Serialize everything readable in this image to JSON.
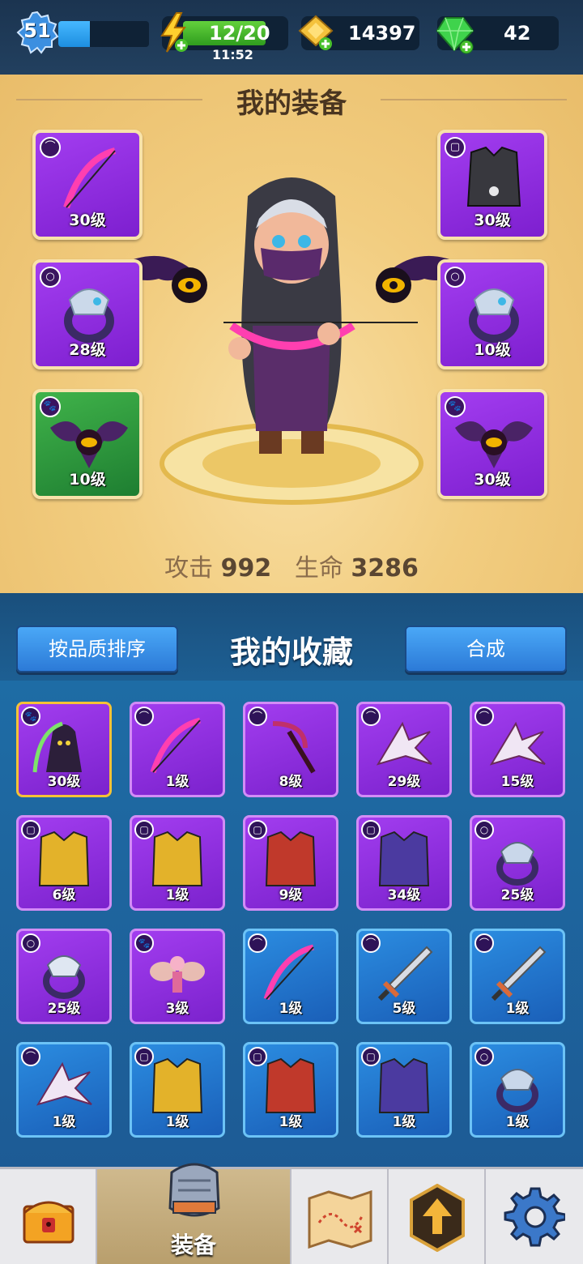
{
  "topbar": {
    "player_level": "51",
    "xp_progress": 0.35,
    "energy": "12/20",
    "energy_timer": "11:52",
    "gold": "14397",
    "gems": "42"
  },
  "equipment": {
    "title": "我的装备",
    "slots": [
      {
        "slot": "weapon",
        "level": "30级",
        "icon": "bow-icon",
        "rarity": "purple"
      },
      {
        "slot": "armor",
        "level": "30级",
        "icon": "armor-icon",
        "rarity": "purple"
      },
      {
        "slot": "ring",
        "level": "28级",
        "icon": "ring-icon",
        "rarity": "purple"
      },
      {
        "slot": "ring",
        "level": "10级",
        "icon": "ring-icon",
        "rarity": "purple"
      },
      {
        "slot": "pet",
        "level": "10级",
        "icon": "bat-pet-icon",
        "rarity": "green"
      },
      {
        "slot": "pet",
        "level": "30级",
        "icon": "bat-pet-icon",
        "rarity": "purple"
      }
    ],
    "stats": {
      "attack_label": "攻击",
      "attack_value": "992",
      "hp_label": "生命",
      "hp_value": "3286"
    }
  },
  "collection": {
    "sort_button": "按品质排序",
    "title": "我的收藏",
    "merge_button": "合成",
    "items": [
      {
        "level": "30级",
        "icon": "reaper-pet-icon",
        "type": "pet",
        "rarity": "purple"
      },
      {
        "level": "1级",
        "icon": "bow-icon",
        "type": "weapon",
        "rarity": "purple"
      },
      {
        "level": "8级",
        "icon": "scythe-icon",
        "type": "weapon",
        "rarity": "purple"
      },
      {
        "level": "29级",
        "icon": "shuriken-icon",
        "type": "weapon",
        "rarity": "purple"
      },
      {
        "level": "15级",
        "icon": "shuriken-icon",
        "type": "weapon",
        "rarity": "purple"
      },
      {
        "level": "6级",
        "icon": "gold-armor-icon",
        "type": "armor",
        "rarity": "purple"
      },
      {
        "level": "1级",
        "icon": "gold-armor-icon",
        "type": "armor",
        "rarity": "purple"
      },
      {
        "level": "9级",
        "icon": "cloak-armor-icon",
        "type": "armor",
        "rarity": "purple"
      },
      {
        "level": "34级",
        "icon": "vest-armor-icon",
        "type": "armor",
        "rarity": "purple"
      },
      {
        "level": "25级",
        "icon": "bear-ring-icon",
        "type": "ring",
        "rarity": "purple"
      },
      {
        "level": "25级",
        "icon": "wolf-ring-icon",
        "type": "ring",
        "rarity": "purple"
      },
      {
        "level": "3级",
        "icon": "fairy-pet-icon",
        "type": "pet",
        "rarity": "purple"
      },
      {
        "level": "1级",
        "icon": "bow-icon",
        "type": "weapon",
        "rarity": "blue"
      },
      {
        "level": "5级",
        "icon": "sword-icon",
        "type": "weapon",
        "rarity": "blue"
      },
      {
        "level": "1级",
        "icon": "sword-icon",
        "type": "weapon",
        "rarity": "blue"
      },
      {
        "level": "1级",
        "icon": "shuriken-icon",
        "type": "weapon",
        "rarity": "blue"
      },
      {
        "level": "1级",
        "icon": "gold-armor-icon",
        "type": "armor",
        "rarity": "blue"
      },
      {
        "level": "1级",
        "icon": "cloak-armor-icon",
        "type": "armor",
        "rarity": "blue"
      },
      {
        "level": "1级",
        "icon": "vest-armor-icon",
        "type": "armor",
        "rarity": "blue"
      },
      {
        "level": "1级",
        "icon": "bear-ring-icon",
        "type": "ring",
        "rarity": "blue"
      }
    ]
  },
  "nav": {
    "equipment_label": "装备"
  },
  "colors": {
    "purple": "#8e2fe0",
    "blue": "#2a86dc",
    "green": "#2f9a3e",
    "gold_panel": "#f2cd80"
  }
}
